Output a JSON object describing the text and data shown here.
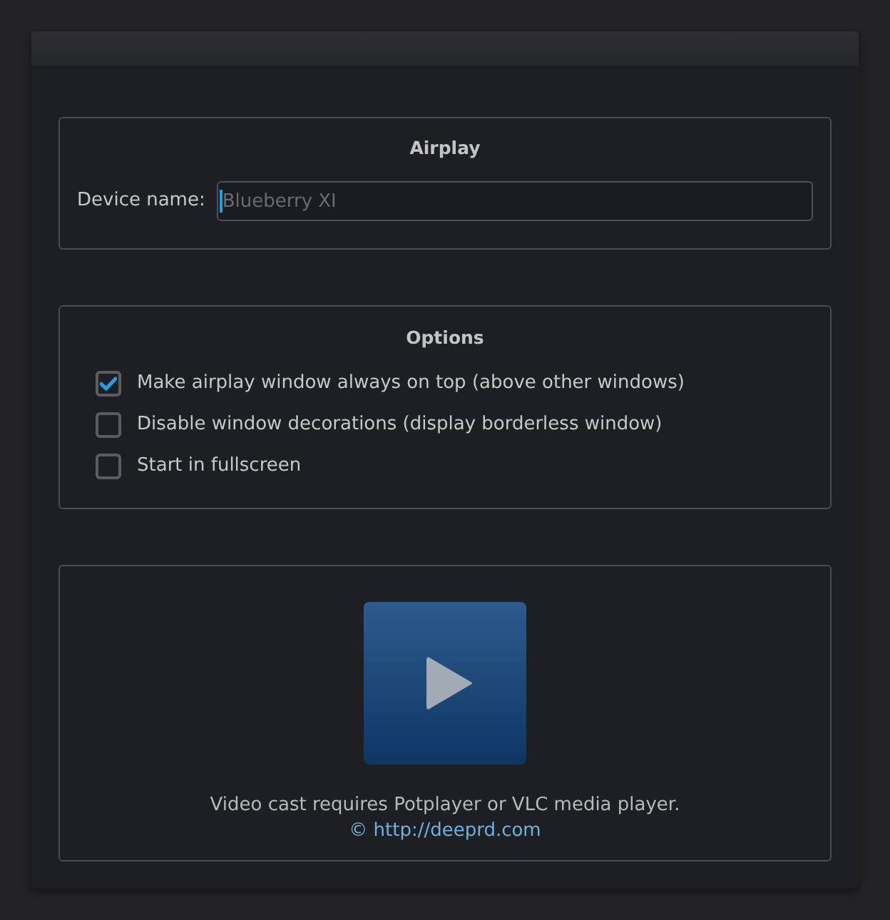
{
  "airplay": {
    "title": "Airplay",
    "device_name": {
      "label": "Device name:",
      "placeholder": "Blueberry XI",
      "focused": true
    }
  },
  "options": {
    "title": "Options",
    "items": [
      {
        "label": "Make airplay window always on top (above other windows)",
        "checked": true
      },
      {
        "label": "Disable window decorations (display borderless window)",
        "checked": false
      },
      {
        "label": "Start in fullscreen",
        "checked": false
      }
    ]
  },
  "player": {
    "message": "Video cast requires Potplayer or VLC media player.",
    "link": "© http://deeprd.com"
  }
}
